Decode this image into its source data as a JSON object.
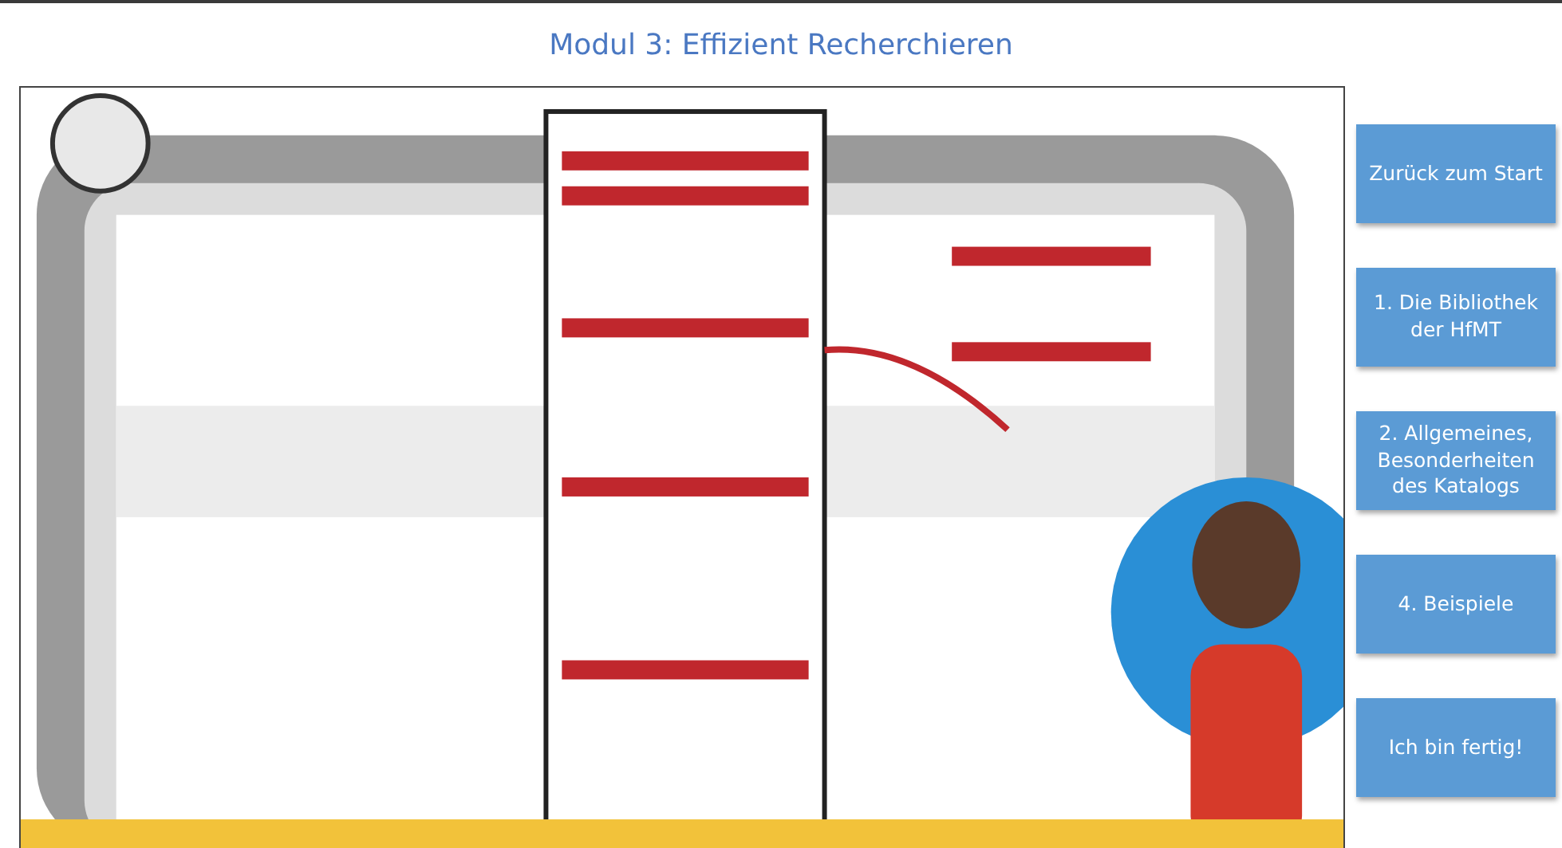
{
  "header": {
    "title": "Modul 3: Effizient Recherchieren"
  },
  "nav_buttons": [
    {
      "label": "Zurück zum Start"
    },
    {
      "label": "1. Die Bibliothek der HfMT"
    },
    {
      "label": "2. Allgemeines, Besonderheiten des Katalogs"
    },
    {
      "label": "4. Beispiele"
    },
    {
      "label": "Ich bin fertig!"
    }
  ]
}
